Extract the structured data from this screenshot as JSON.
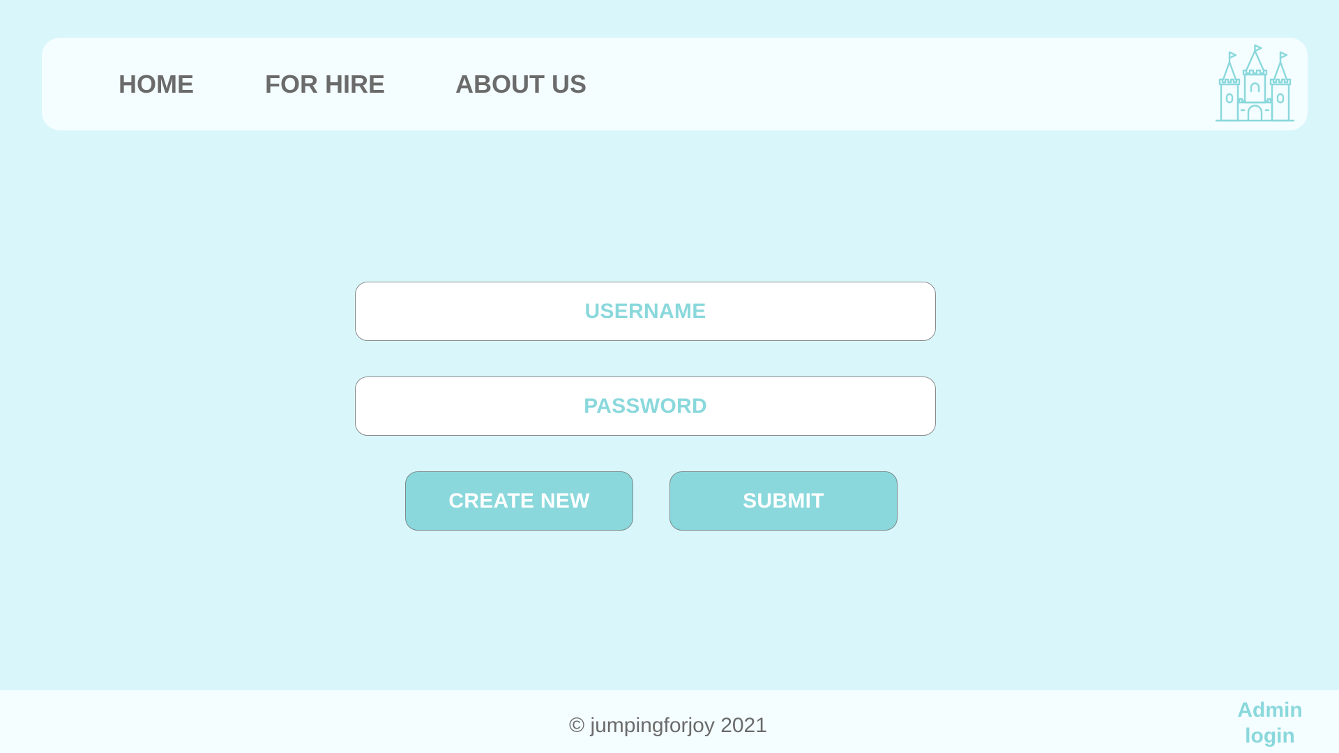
{
  "nav": {
    "links": [
      {
        "label": "HOME"
      },
      {
        "label": "FOR HIRE"
      },
      {
        "label": "ABOUT US"
      }
    ],
    "logo_icon": "castle-icon"
  },
  "login_form": {
    "username_placeholder": "USERNAME",
    "username_value": "",
    "password_placeholder": "PASSWORD",
    "password_value": "",
    "create_new_label": "CREATE NEW",
    "submit_label": "SUBMIT"
  },
  "footer": {
    "copyright": "© jumpingforjoy 2021",
    "admin_login_line1": "Admin",
    "admin_login_line2": "login"
  },
  "colors": {
    "page_background": "#d9f6fb",
    "panel_background": "#f4fdff",
    "accent": "#8ad8dc",
    "nav_text": "#6b6b6b"
  }
}
